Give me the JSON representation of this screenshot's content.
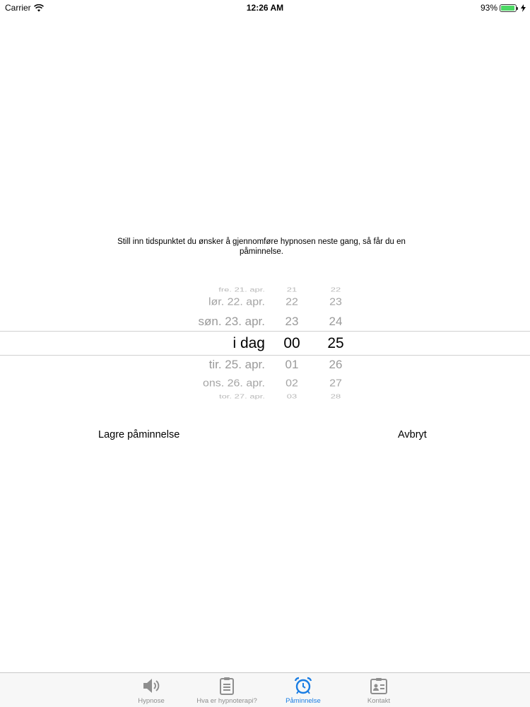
{
  "status_bar": {
    "carrier": "Carrier",
    "time": "12:26 AM",
    "battery": "93%",
    "battery_level": 0.93
  },
  "instruction": "Still inn tidspunktet du ønsker å gjennomføre hypnosen neste gang, så får du en påminnelse.",
  "picker": {
    "rows": [
      {
        "date": "fre. 21. apr.",
        "hour": "21",
        "minute": "22"
      },
      {
        "date": "lør. 22. apr.",
        "hour": "22",
        "minute": "23"
      },
      {
        "date": "søn. 23. apr.",
        "hour": "23",
        "minute": "24"
      },
      {
        "date": "i dag",
        "hour": "00",
        "minute": "25"
      },
      {
        "date": "tir. 25. apr.",
        "hour": "01",
        "minute": "26"
      },
      {
        "date": "ons. 26. apr.",
        "hour": "02",
        "minute": "27"
      },
      {
        "date": "tor. 27. apr.",
        "hour": "03",
        "minute": "28"
      }
    ]
  },
  "actions": {
    "save_label": "Lagre påminnelse",
    "cancel_label": "Avbryt"
  },
  "tabs": [
    {
      "label": "Hypnose",
      "icon": "speaker-icon"
    },
    {
      "label": "Hva er hypnoterapi?",
      "icon": "clipboard-icon"
    },
    {
      "label": "Påminnelse",
      "icon": "alarm-clock-icon"
    },
    {
      "label": "Kontakt",
      "icon": "contact-card-icon"
    }
  ],
  "colors": {
    "accent": "#1a7de3",
    "inactive": "#8e8e8e",
    "battery": "#4cd964"
  }
}
